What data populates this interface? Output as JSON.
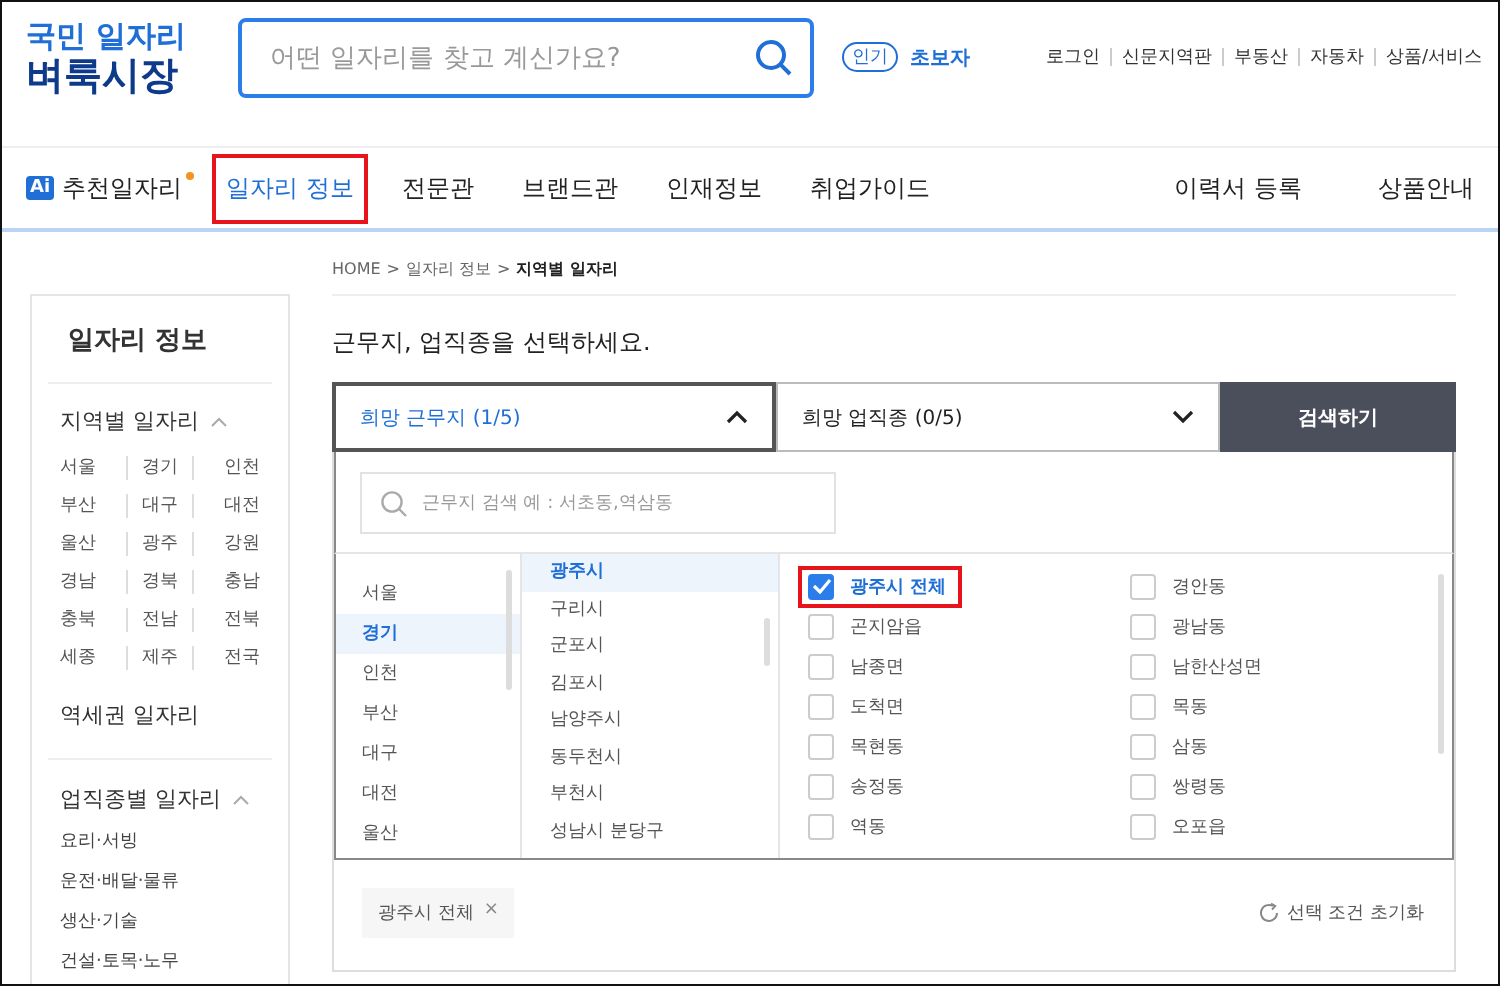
{
  "logo": {
    "line1": "국민 일자리",
    "line2": "벼룩시장"
  },
  "search": {
    "placeholder": "어떤 일자리를 찾고 계신가요?"
  },
  "popular": {
    "badge": "인기",
    "keyword": "초보자"
  },
  "top_links": [
    "로그인",
    "신문지역판",
    "부동산",
    "자동차",
    "상품/서비스"
  ],
  "nav": {
    "ai_badge": "Ai",
    "ai_label": "추천일자리",
    "items": [
      {
        "label": "일자리 정보",
        "selected": true,
        "highlight": true
      },
      {
        "label": "전문관",
        "selected": false,
        "highlight": false
      },
      {
        "label": "브랜드관",
        "selected": false,
        "highlight": false
      },
      {
        "label": "인재정보",
        "selected": false,
        "highlight": false
      },
      {
        "label": "취업가이드",
        "selected": false,
        "highlight": false
      }
    ],
    "right": [
      "이력서 등록",
      "상품안내"
    ]
  },
  "breadcrumb": [
    "HOME",
    "일자리 정보",
    "지역별 일자리"
  ],
  "breadcrumb_sep": ">",
  "sidebar": {
    "title": "일자리 정보",
    "region_heading": "지역별 일자리",
    "regions": [
      "서울",
      "경기",
      "인천",
      "부산",
      "대구",
      "대전",
      "울산",
      "광주",
      "강원",
      "경남",
      "경북",
      "충남",
      "충북",
      "전남",
      "전북",
      "세종",
      "제주",
      "전국"
    ],
    "station": "역세권 일자리",
    "job_heading": "업직종별 일자리",
    "jobs": [
      "요리·서빙",
      "운전·배달·물류",
      "생산·기술",
      "건설·토목·노무"
    ]
  },
  "main": {
    "title": "근무지, 업직종을 선택하세요.",
    "tabs": [
      {
        "label": "희망 근무지 (1/5)",
        "selected": true,
        "expanded": true
      },
      {
        "label": "희망 업직종 (0/5)",
        "selected": false,
        "expanded": false
      }
    ],
    "search_button": "검색하기",
    "area_search": {
      "placeholder": "근무지 검색 예 : 서초동,역삼동"
    },
    "provinces": [
      {
        "label": "서울",
        "selected": false
      },
      {
        "label": "경기",
        "selected": true
      },
      {
        "label": "인천",
        "selected": false
      },
      {
        "label": "부산",
        "selected": false
      },
      {
        "label": "대구",
        "selected": false
      },
      {
        "label": "대전",
        "selected": false
      },
      {
        "label": "울산",
        "selected": false
      }
    ],
    "cities": [
      {
        "label": "광주시",
        "selected": true
      },
      {
        "label": "구리시",
        "selected": false
      },
      {
        "label": "군포시",
        "selected": false
      },
      {
        "label": "김포시",
        "selected": false
      },
      {
        "label": "남양주시",
        "selected": false
      },
      {
        "label": "동두천시",
        "selected": false
      },
      {
        "label": "부천시",
        "selected": false
      },
      {
        "label": "성남시 분당구",
        "selected": false
      }
    ],
    "districts": [
      {
        "label": "광주시 전체",
        "checked": true,
        "highlight": true
      },
      {
        "label": "경안동",
        "checked": false,
        "highlight": false
      },
      {
        "label": "곤지암읍",
        "checked": false,
        "highlight": false
      },
      {
        "label": "광남동",
        "checked": false,
        "highlight": false
      },
      {
        "label": "남종면",
        "checked": false,
        "highlight": false
      },
      {
        "label": "남한산성면",
        "checked": false,
        "highlight": false
      },
      {
        "label": "도척면",
        "checked": false,
        "highlight": false
      },
      {
        "label": "목동",
        "checked": false,
        "highlight": false
      },
      {
        "label": "목현동",
        "checked": false,
        "highlight": false
      },
      {
        "label": "삼동",
        "checked": false,
        "highlight": false
      },
      {
        "label": "송정동",
        "checked": false,
        "highlight": false
      },
      {
        "label": "쌍령동",
        "checked": false,
        "highlight": false
      },
      {
        "label": "역동",
        "checked": false,
        "highlight": false
      },
      {
        "label": "오포읍",
        "checked": false,
        "highlight": false
      }
    ],
    "chips": [
      {
        "label": "광주시 전체",
        "remove": "×"
      }
    ],
    "reset": "선택 조건 초기화"
  }
}
